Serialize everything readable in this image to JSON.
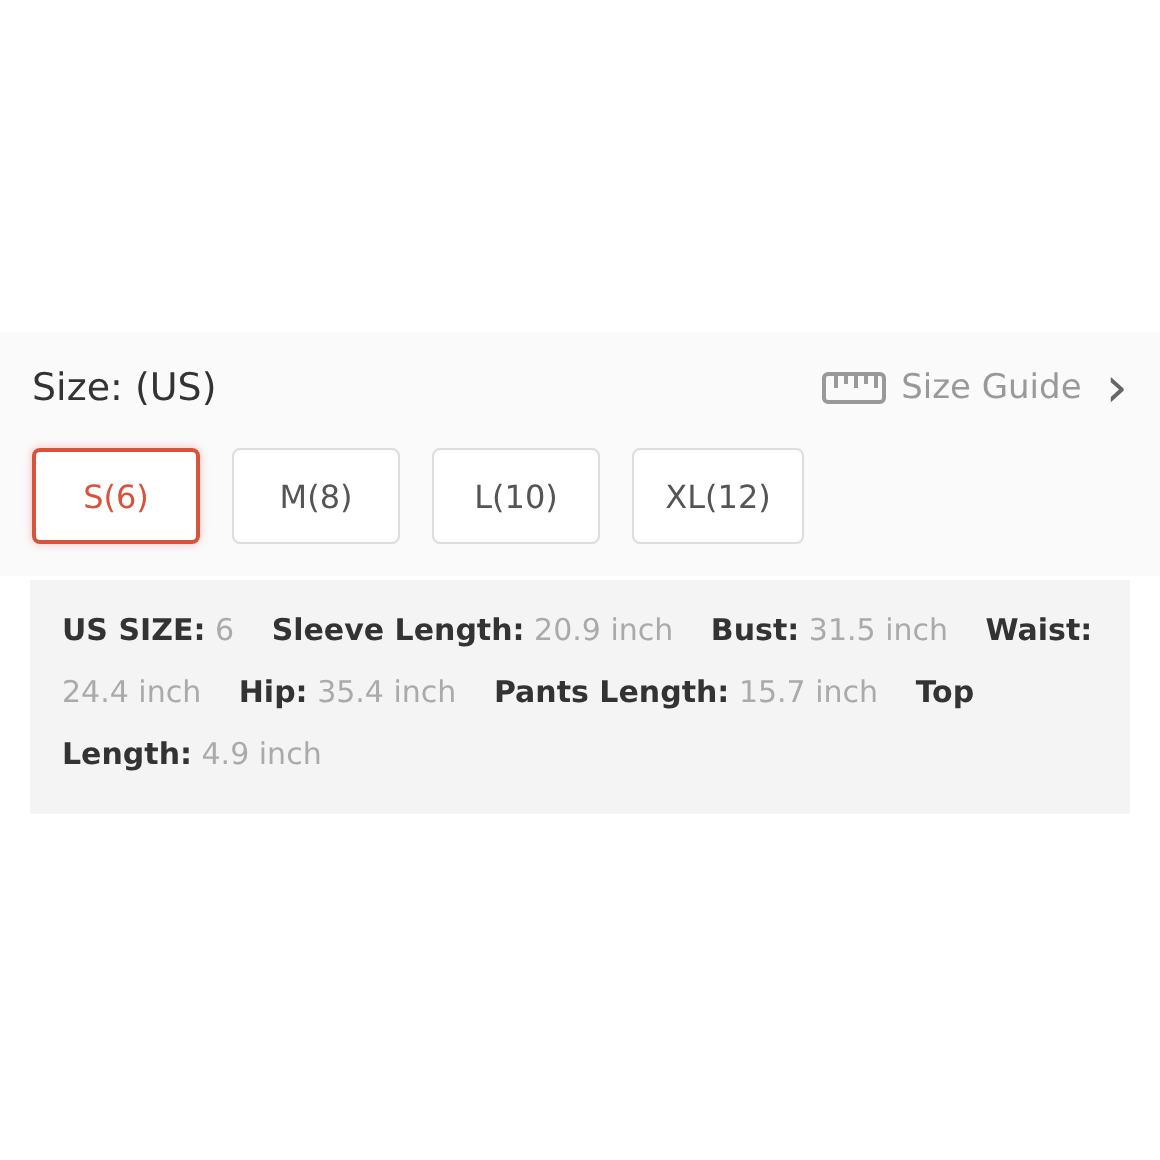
{
  "title": "Size: (US)",
  "size_guide": {
    "label": "Size Guide",
    "chevron": "›"
  },
  "sizes": [
    {
      "label": "S(6)",
      "selected": true
    },
    {
      "label": "M(8)",
      "selected": false
    },
    {
      "label": "L(10)",
      "selected": false
    },
    {
      "label": "XL(12)",
      "selected": false
    }
  ],
  "measurements": "**US SIZE:** 6 **Sleeve Length:** 20.9 inch **Bust:** 31.5 inch **Waist:** 24.4 inch **Hip:** 35.4 inch **Pants Length:** 15.7 inch **Top Length:** 4.9 inch"
}
